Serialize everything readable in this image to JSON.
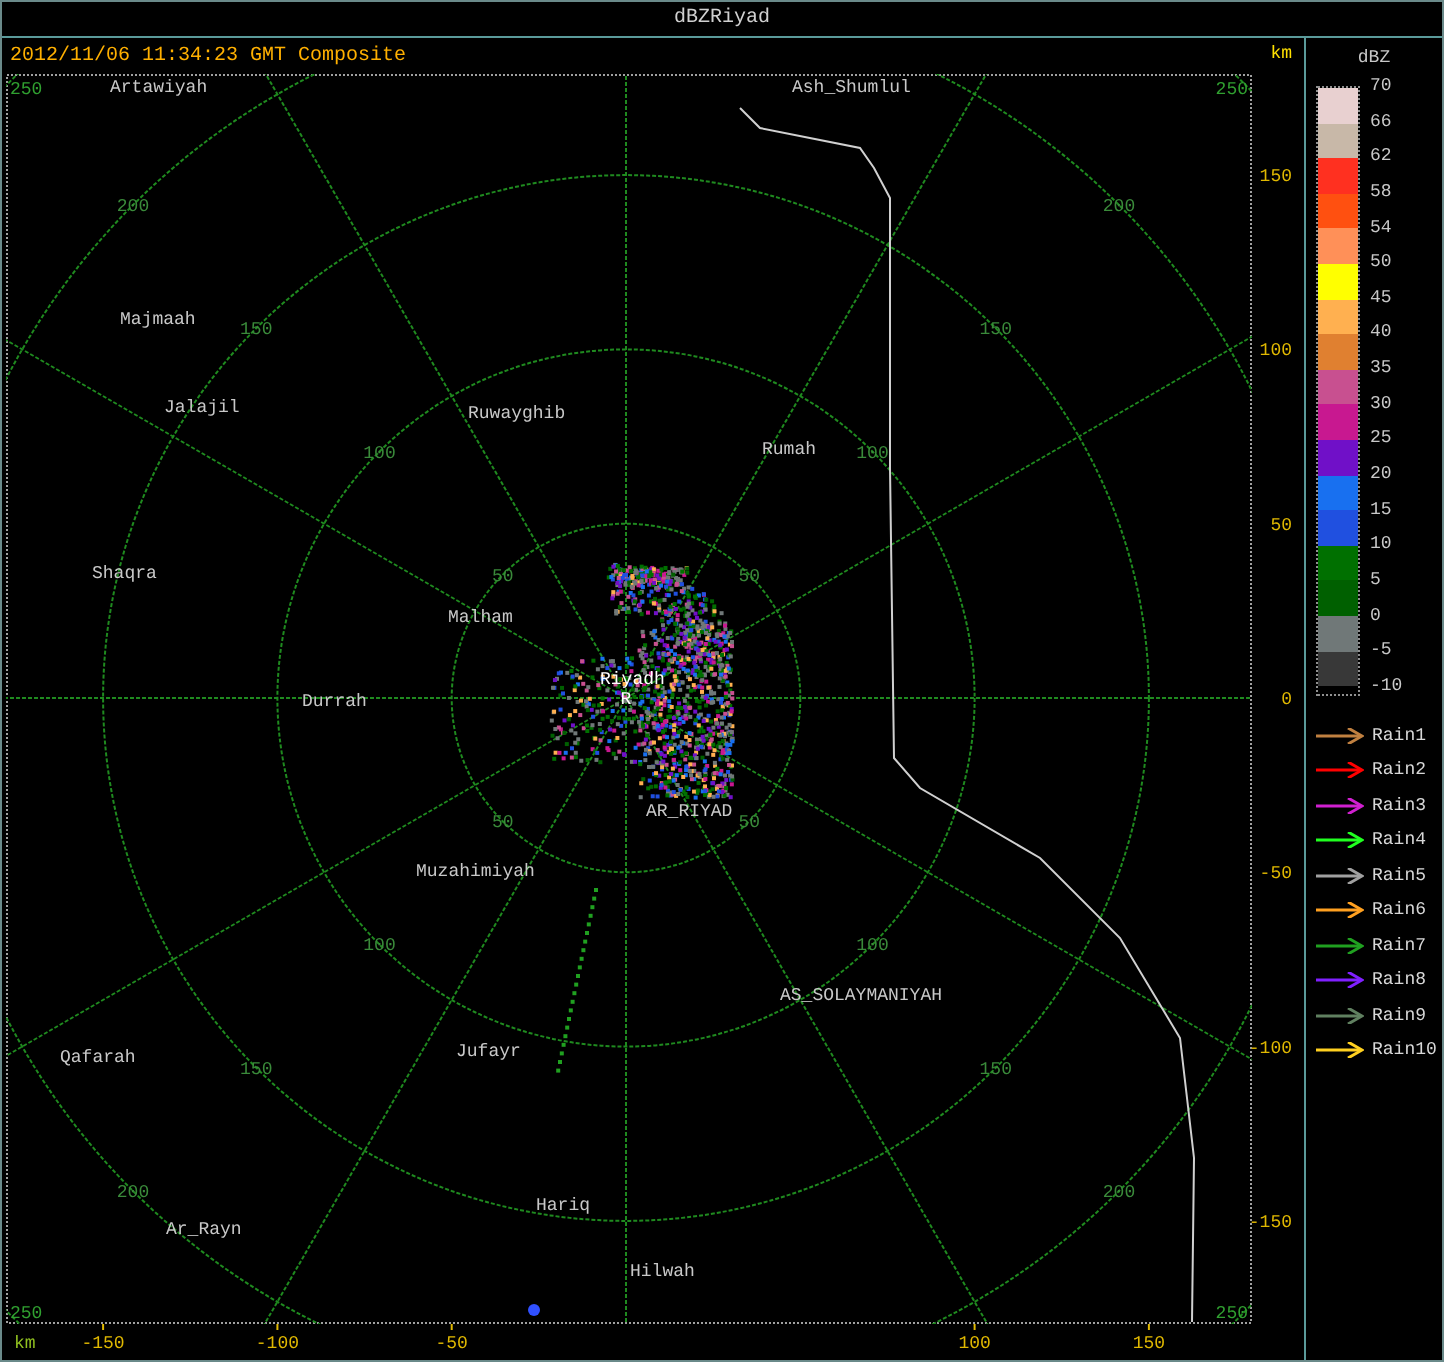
{
  "window": {
    "title": "dBZRiyad"
  },
  "header": {
    "timestamp": "2012/11/06 11:34:23 GMT Composite",
    "unit": "km"
  },
  "radar_map": {
    "places": [
      {
        "name": "Artawiyah"
      },
      {
        "name": "Ash_Shumlul"
      },
      {
        "name": "Majmaah"
      },
      {
        "name": "Jalajil"
      },
      {
        "name": "Ruwayghib"
      },
      {
        "name": "Rumah"
      },
      {
        "name": "Shaqra"
      },
      {
        "name": "Malham"
      },
      {
        "name": "Durrah"
      },
      {
        "name": "Riyadh"
      },
      {
        "name": "AR_RIYAD"
      },
      {
        "name": "Muzahimiyah"
      },
      {
        "name": "AS_SOLAYMANIYAH"
      },
      {
        "name": "Qafarah"
      },
      {
        "name": "Jufayr"
      },
      {
        "name": "Ar_Rayn"
      },
      {
        "name": "Hariq"
      },
      {
        "name": "Hilwah"
      }
    ],
    "site_marker": "R",
    "range_rings": [
      {
        "labels": [
          "50",
          "50",
          "50",
          "50"
        ]
      },
      {
        "labels": [
          "100",
          "100",
          "100",
          "100"
        ]
      },
      {
        "labels": [
          "150",
          "150",
          "150",
          "150"
        ]
      },
      {
        "labels": [
          "200",
          "200",
          "200",
          "200"
        ]
      }
    ],
    "corner_labels": [
      "250",
      "250",
      "250",
      "250"
    ],
    "y_axis": {
      "ticks": [
        "150",
        "100",
        "50",
        "0",
        "-50",
        "-100",
        "-150"
      ]
    }
  },
  "x_axis": {
    "unit": "km",
    "ticks": [
      "-150",
      "-100",
      "-50",
      "100",
      "150"
    ]
  },
  "legend": {
    "title": "dBZ",
    "scale_labels": [
      "70",
      "66",
      "62",
      "58",
      "54",
      "50",
      "45",
      "40",
      "35",
      "30",
      "25",
      "20",
      "15",
      "10",
      "5",
      "0",
      "-5",
      "-10"
    ],
    "bands": [
      {
        "color": "#e8d0d0"
      },
      {
        "color": "#c8b8a8"
      },
      {
        "color": "#ff3020"
      },
      {
        "color": "#ff5010"
      },
      {
        "color": "#ff9058"
      },
      {
        "color": "#ffff00"
      },
      {
        "color": "#ffb050"
      },
      {
        "color": "#e08030"
      },
      {
        "color": "#c85090"
      },
      {
        "color": "#c81890"
      },
      {
        "color": "#7010c8"
      },
      {
        "color": "#1870f0"
      },
      {
        "color": "#2050e0"
      },
      {
        "color": "#007000"
      },
      {
        "color": "#006000"
      },
      {
        "color": "#707878"
      },
      {
        "color": "#383838"
      }
    ]
  },
  "tracks": [
    {
      "name": "Rain1",
      "color": "#c08040"
    },
    {
      "name": "Rain2",
      "color": "#ff0000"
    },
    {
      "name": "Rain3",
      "color": "#d020d0"
    },
    {
      "name": "Rain4",
      "color": "#20ff20"
    },
    {
      "name": "Rain5",
      "color": "#a0a0a0"
    },
    {
      "name": "Rain6",
      "color": "#ffa020"
    },
    {
      "name": "Rain7",
      "color": "#20a020"
    },
    {
      "name": "Rain8",
      "color": "#8020ff"
    },
    {
      "name": "Rain9",
      "color": "#608060"
    },
    {
      "name": "Rain10",
      "color": "#ffd020"
    }
  ]
}
